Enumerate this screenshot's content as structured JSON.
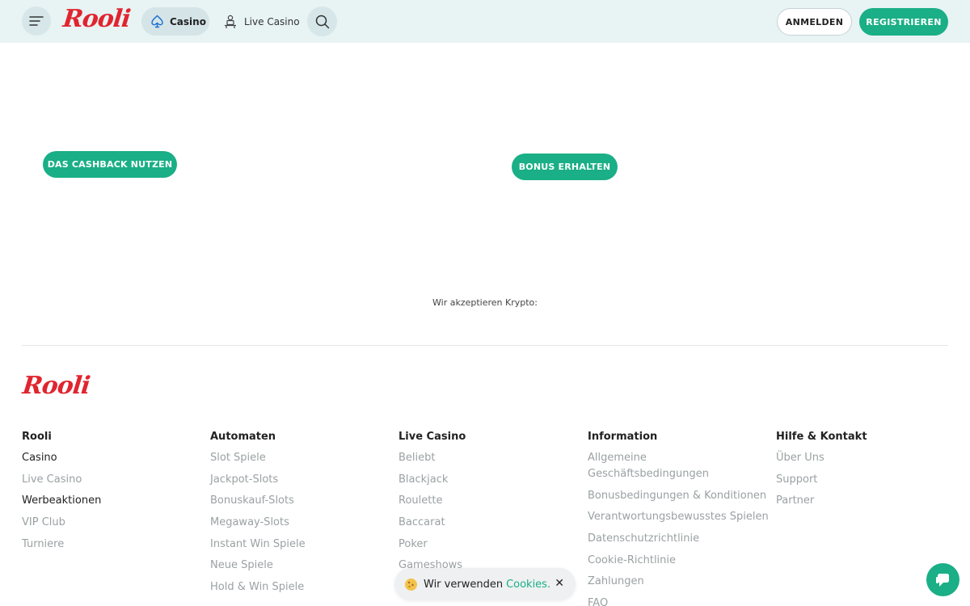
{
  "header": {
    "logo": "Rooli",
    "nav_casino": "Casino",
    "nav_live_casino": "Live Casino",
    "login": "ANMELDEN",
    "register": "REGISTRIEREN"
  },
  "promos": {
    "cashback": "DAS CASHBACK NUTZEN",
    "bonus": "BONUS ERHALTEN"
  },
  "crypto_text": "Wir akzeptieren Krypto:",
  "footer": {
    "logo": "Rooli",
    "columns": [
      {
        "title": "Rooli",
        "links": [
          "Casino",
          "Live Casino",
          "Werbeaktionen",
          "VIP Club",
          "Turniere"
        ]
      },
      {
        "title": "Automaten",
        "links": [
          "Slot Spiele",
          "Jackpot-Slots",
          "Bonuskauf-Slots",
          "Megaway-Slots",
          "Instant Win Spiele",
          "Neue Spiele",
          "Hold & Win Spiele"
        ]
      },
      {
        "title": "Live Casino",
        "links": [
          "Beliebt",
          "Blackjack",
          "Roulette",
          "Baccarat",
          "Poker",
          "Gameshows"
        ]
      },
      {
        "title": "Information",
        "links": [
          "Allgemeine Geschäftsbedingungen",
          "Bonusbedingungen & Konditionen",
          "Verantwortungsbewusstes Spielen",
          "Datenschutzrichtlinie",
          "Cookie-Richtlinie",
          "Zahlungen",
          "FAQ"
        ]
      },
      {
        "title": "Hilfe & Kontakt",
        "links": [
          "Über Uns",
          "Support",
          "Partner"
        ]
      }
    ]
  },
  "cookie": {
    "text": "Wir verwenden",
    "link": "Cookies."
  },
  "colors": {
    "brand_red": "#e0252f",
    "accent_green": "#1aaf86",
    "header_bg": "#e8f3f4"
  }
}
